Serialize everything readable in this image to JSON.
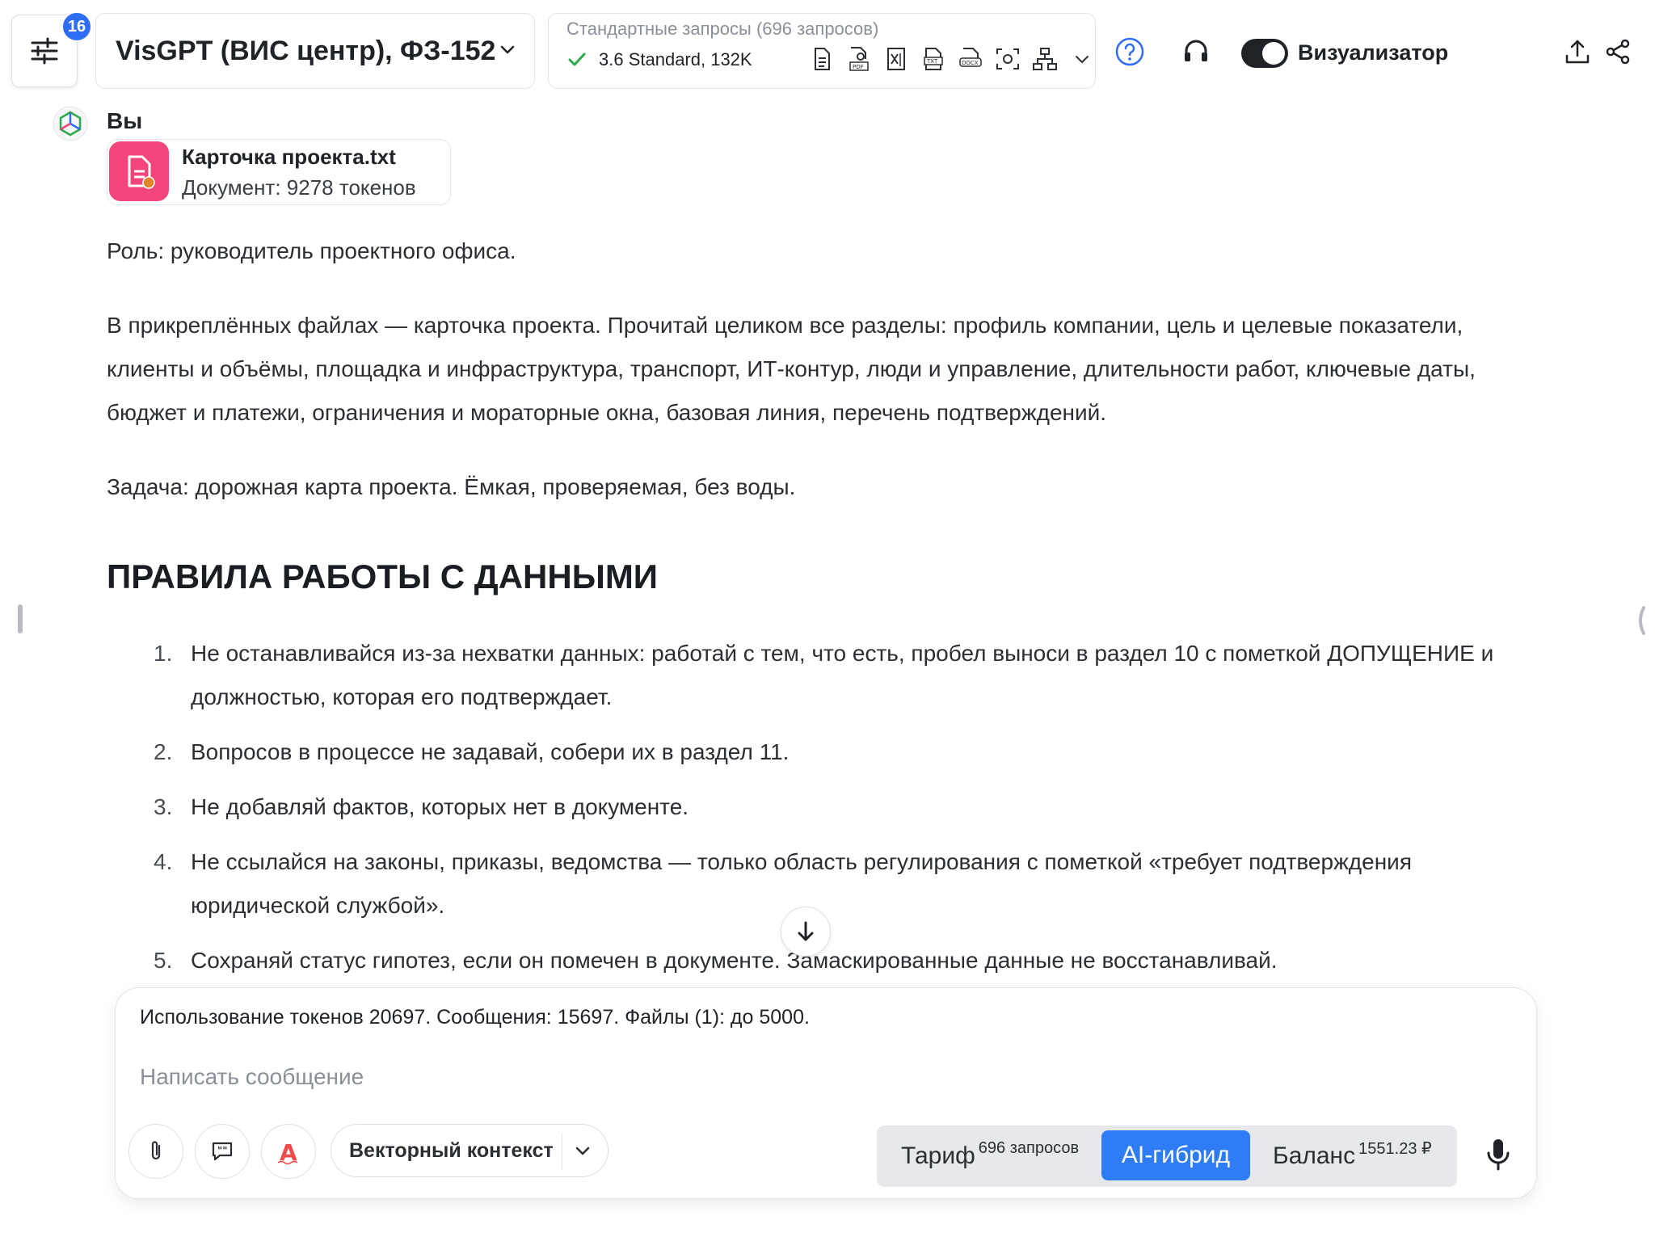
{
  "topbar": {
    "badge_count": "16",
    "model_label": "VisGPT (ВИС центр), ФЗ-152",
    "plan_title": "Стандартные запросы (696 запросов)",
    "plan_model": "3.6 Standard, 132K",
    "visualizer_label": "Визуализатор",
    "visualizer_on": true,
    "file_type_icons": [
      "doc-icon",
      "pdf-icon",
      "xls-icon",
      "txt-icon",
      "docx-icon",
      "scan-icon",
      "structure-icon"
    ]
  },
  "message": {
    "sender": "Вы",
    "file": {
      "name": "Карточка проекта.txt",
      "meta": "Документ: 9278 токенов"
    },
    "role": "Роль: руководитель проектного офиса.",
    "intro": "В прикреплённых файлах — карточка проекта. Прочитай целиком все разделы: профиль компании, цель и целевые показатели, клиенты и объёмы, площадка и инфраструктура, транспорт, ИТ-контур, люди и управление, длительности работ, ключевые даты, бюджет и платежи, ограничения и мораторные окна, базовая линия, перечень подтверждений.",
    "task": "Задача: дорожная карта проекта. Ёмкая, проверяемая, без воды.",
    "heading": "ПРАВИЛА РАБОТЫ С ДАННЫМИ",
    "rules": [
      {
        "num": "1.",
        "text": "Не останавливайся из-за нехватки данных: работай с тем, что есть, пробел выноси в раздел 10 с пометкой ДОПУЩЕНИЕ и должностью, которая его подтверждает."
      },
      {
        "num": "2.",
        "text": "Вопросов в процессе не задавай, собери их в раздел 11."
      },
      {
        "num": "3.",
        "text": "Не добавляй фактов, которых нет в документе."
      },
      {
        "num": "4.",
        "text": "Не ссылайся на законы, приказы, ведомства — только область регулирования с пометкой «требует подтверждения юридической службой»."
      },
      {
        "num": "5.",
        "text": "Сохраняй статус гипотез, если он помечен в документе. Замаскированные данные не восстанавливай."
      }
    ]
  },
  "composer": {
    "usage": "Использование токенов 20697. Сообщения: 15697. Файлы (1): до 5000.",
    "placeholder": "Написать сообщение",
    "vector_context": "Векторный контекст",
    "tariff_label": "Тариф",
    "tariff_sup": "696 запросов",
    "ai_hybrid": "AI-гибрид",
    "balance_label": "Баланс",
    "balance_sup": "1551.23 ₽"
  },
  "colors": {
    "accent": "#2f7df6",
    "badge": "#2f6df6",
    "file_icon_bg": "#f2457a",
    "check_green": "#2eaa4a"
  }
}
